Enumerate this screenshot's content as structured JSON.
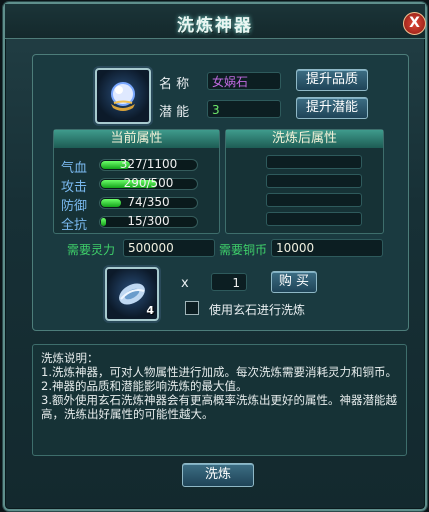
{
  "window": {
    "title": "洗炼神器",
    "close_label": "X"
  },
  "item": {
    "name_label": "名 称",
    "name_value": "女娲石",
    "potential_label": "潜 能",
    "potential_value": "3",
    "upgrade_quality_button": "提升品质",
    "upgrade_potential_button": "提升潜能",
    "icon": "gem-orb-icon"
  },
  "current_attrs": {
    "title": "当前属性",
    "rows": [
      {
        "label": "气血",
        "value": "327/1100",
        "fraction": 0.297
      },
      {
        "label": "攻击",
        "value": "290/500",
        "fraction": 0.58
      },
      {
        "label": "防御",
        "value": "74/350",
        "fraction": 0.211
      },
      {
        "label": "全抗",
        "value": "15/300",
        "fraction": 0.05
      }
    ]
  },
  "after_attrs": {
    "title": "洗炼后属性"
  },
  "requirements": {
    "spirit_label": "需要灵力",
    "spirit_value": "500000",
    "copper_label": "需要铜币",
    "copper_value": "10000"
  },
  "stone": {
    "icon": "xuan-stone-icon",
    "count": "4",
    "multiply_label": "x",
    "quantity_value": "1",
    "buy_button": "购 买",
    "use_checkbox_label": "使用玄石进行洗炼",
    "use_checked": false
  },
  "description": {
    "lines": [
      "洗炼说明：",
      "1.洗炼神器，可对人物属性进行加成。每次洗炼需要消耗灵力和铜币。",
      "2.神器的品质和潜能影响洗炼的最大值。",
      "3.额外使用玄石洗炼神器会有更高概率洗炼出更好的属性。神器潜能越高，洗练出好属性的可能性越大。"
    ]
  },
  "refine_button": "洗炼"
}
